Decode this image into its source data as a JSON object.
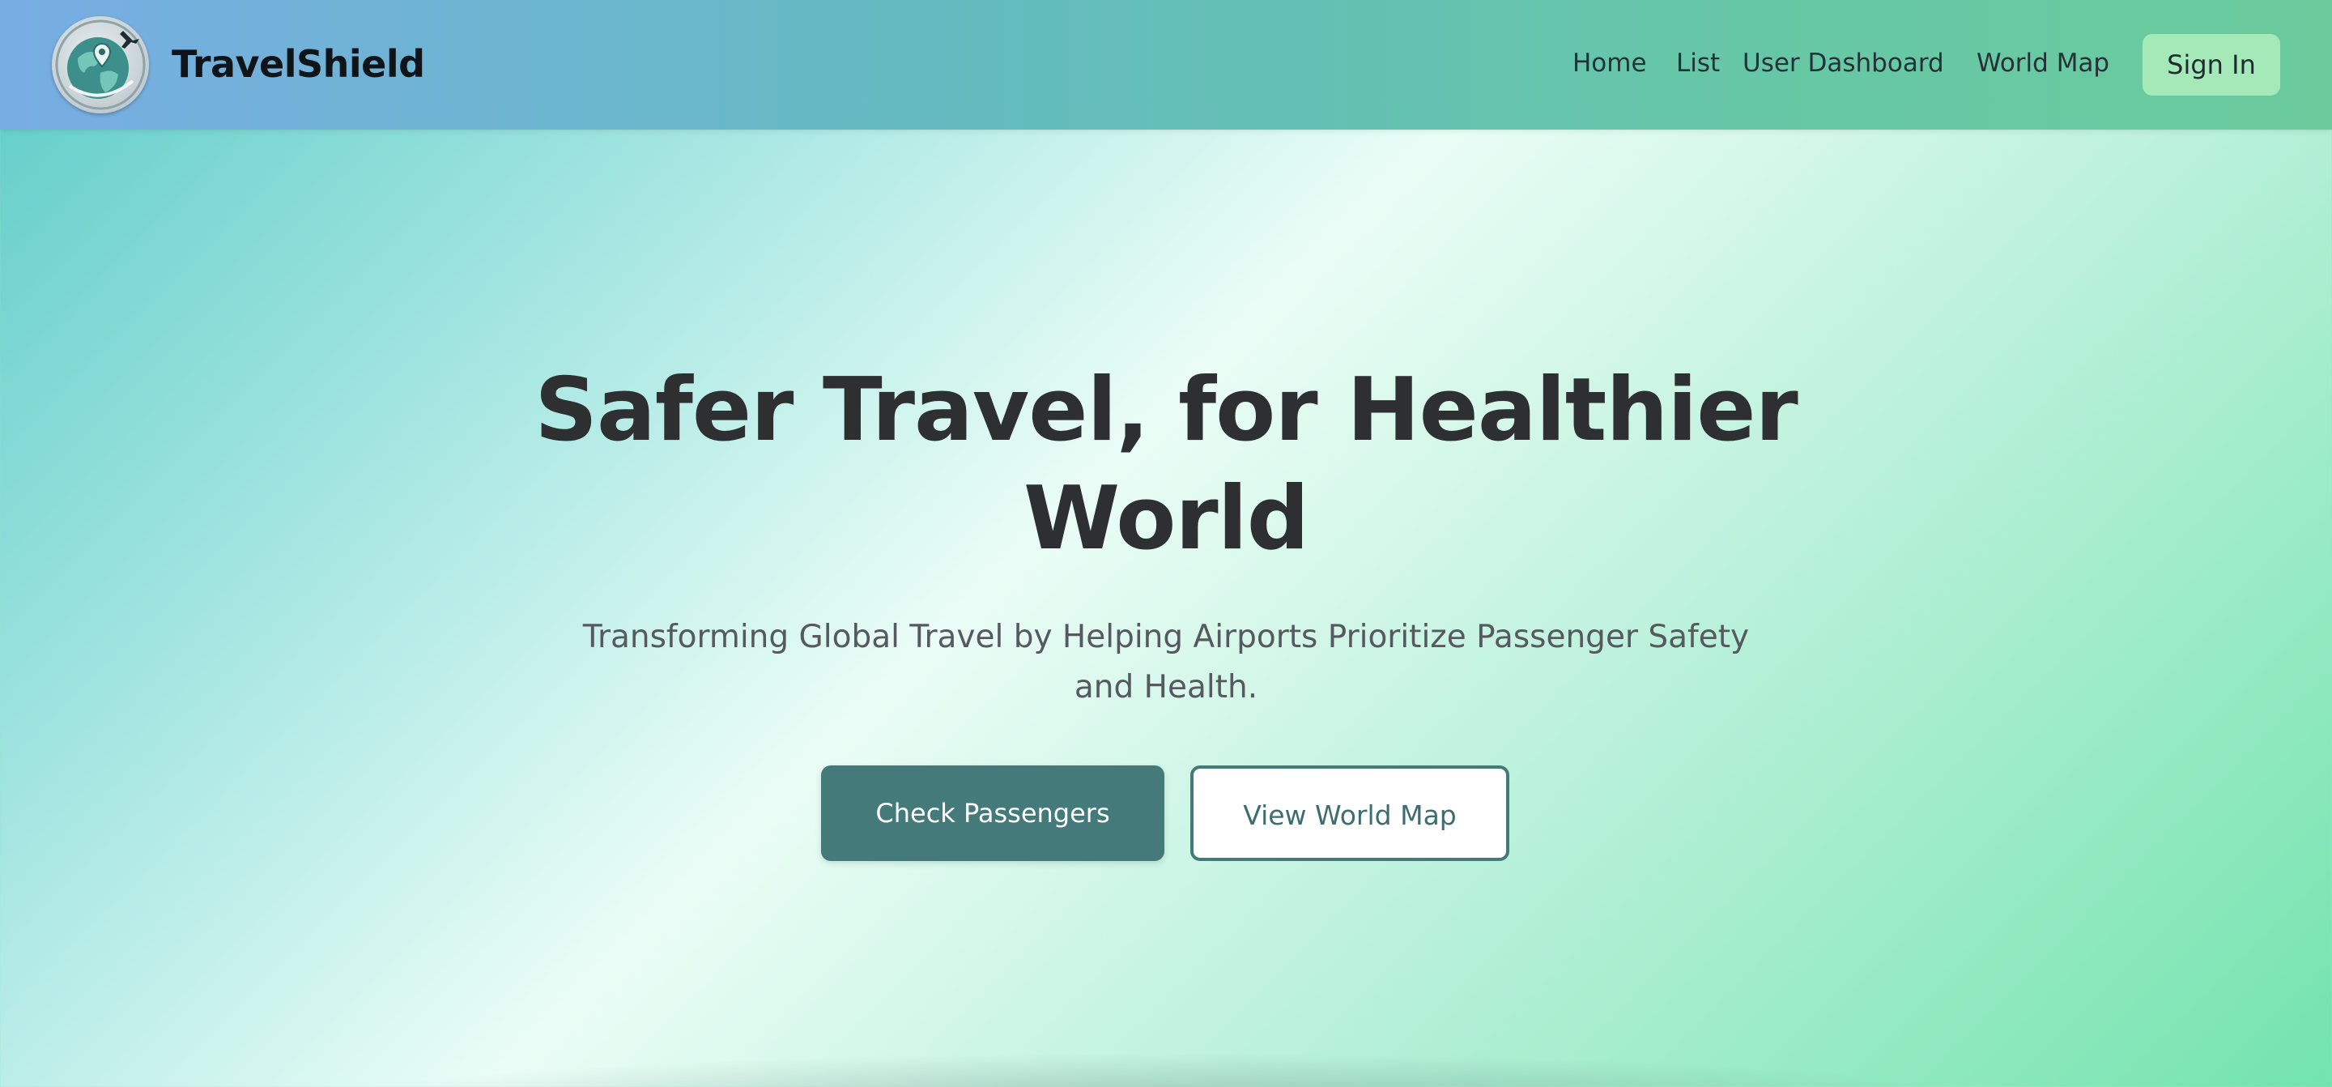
{
  "brand": {
    "name": "TravelShield",
    "logo_icon": "globe-airplane-icon"
  },
  "nav": {
    "links": [
      "Home",
      "List",
      "User Dashboard",
      "World Map"
    ],
    "signin_label": "Sign In"
  },
  "hero": {
    "title_line1": "Safer Travel, for Healthier",
    "title_line2": "World",
    "subtitle_line1": "Transforming Global Travel by Helping Airports Prioritize Passenger Safety",
    "subtitle_line2": "and Health.",
    "primary_button": "Check Passengers",
    "secondary_button": "View World Map"
  },
  "colors": {
    "primary": "#457a7a",
    "signin_bg": "#a6e9b8",
    "title": "#2d2f31"
  }
}
